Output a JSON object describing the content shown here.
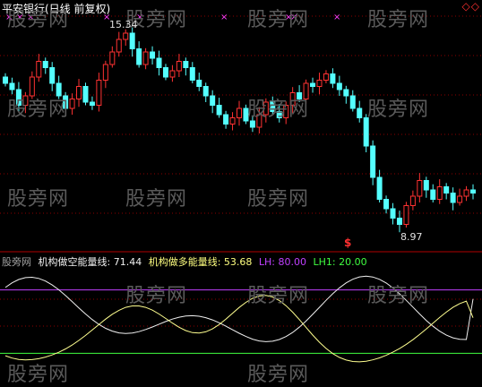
{
  "title": "平安银行(日线 前复权)",
  "top_right_icons": "◇◇",
  "watermark": "股旁网",
  "high_label": "15.34",
  "low_label": "8.97",
  "sell_marker": "$",
  "legend": {
    "source": "股旁网",
    "short_name": "机构做空能量线: 71.44",
    "long_name": "机构做多能量线: 53.68",
    "lh": "LH: 80.00",
    "lh1": "LH1: 20.00"
  },
  "colors": {
    "up": "#ff3232",
    "down": "#54ffff",
    "grid": "#8b0000",
    "short_line": "#f0f0f0",
    "long_line": "#ffff90",
    "lh": "#c040ff",
    "lh1": "#40ff40",
    "marker": "#ff40ff"
  },
  "chart_data": [
    {
      "type": "candlestick",
      "title": "平安银行(日线 前复权)",
      "annotations": [
        {
          "text": "15.34",
          "kind": "high"
        },
        {
          "text": "8.97",
          "kind": "low"
        }
      ],
      "close": [
        13.6,
        13.4,
        12.9,
        13.2,
        13.8,
        14.3,
        14.1,
        13.6,
        13.2,
        12.8,
        13.1,
        13.5,
        13.0,
        12.9,
        13.7,
        14.2,
        14.6,
        15.0,
        15.2,
        14.7,
        14.2,
        14.6,
        14.4,
        14.1,
        13.8,
        14.0,
        14.3,
        14.1,
        13.7,
        13.5,
        13.2,
        12.9,
        12.6,
        12.3,
        12.5,
        12.8,
        12.4,
        12.2,
        12.6,
        13.0,
        12.7,
        12.5,
        12.9,
        13.3,
        13.1,
        13.6,
        13.5,
        13.7,
        13.9,
        13.6,
        13.4,
        13.2,
        12.8,
        12.5,
        11.6,
        10.6,
        9.9,
        9.6,
        9.3,
        9.1,
        9.7,
        10.0,
        10.5,
        10.2,
        9.9,
        10.3,
        10.1,
        9.8,
        10.0,
        10.2,
        10.1
      ],
      "lh": 80,
      "lh1": 20,
      "series": [
        {
          "name": "机构做空能量线",
          "last": 71.44
        },
        {
          "name": "机构做多能量线",
          "last": 53.68
        }
      ]
    }
  ]
}
